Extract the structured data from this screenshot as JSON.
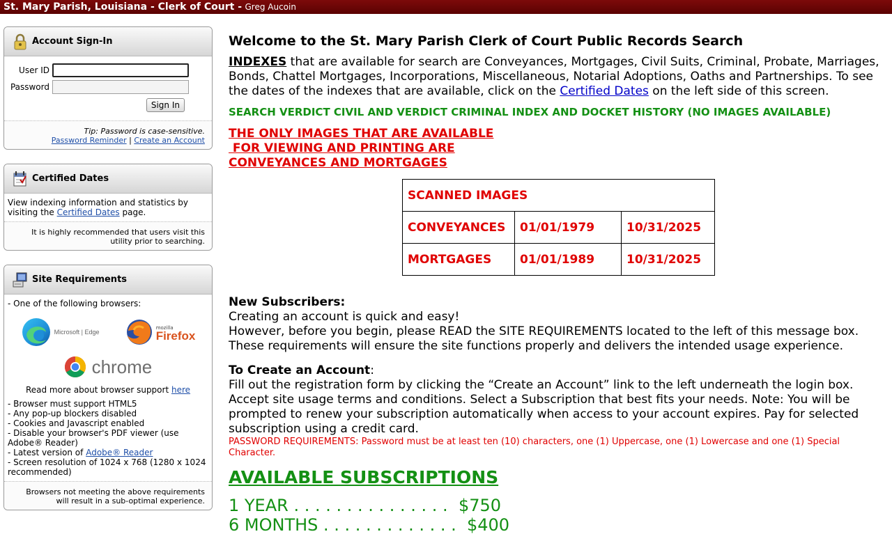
{
  "header": {
    "title": "St. Mary Parish, Louisiana - Clerk of Court -",
    "clerk_name": "Greg Aucoin"
  },
  "sidebar": {
    "signin": {
      "title": "Account Sign-In",
      "user_id_label": "User ID",
      "password_label": "Password",
      "user_id_value": "",
      "password_value": "",
      "signin_button": "Sign In",
      "tip": "Tip: Password is case-sensitive.",
      "password_reminder": "Password Reminder",
      "separator": "|",
      "create_account": "Create an Account"
    },
    "certified": {
      "title": "Certified Dates",
      "text_before": "View indexing information and statistics by visiting the",
      "link": "Certified Dates",
      "text_after": "page.",
      "footer": "It is highly recommended that users visit this utility prior to searching."
    },
    "requirements": {
      "title": "Site Requirements",
      "intro": "- One of the following browsers:",
      "edge_label": "Microsoft | Edge",
      "firefox_small": "mozilla",
      "firefox_label": "Firefox",
      "chrome_label": "chrome",
      "read_more": "Read more about browser support",
      "read_more_link": "here",
      "items": [
        "- Browser must support HTML5",
        "- Any pop-up blockers disabled",
        "- Cookies and Javascript enabled",
        "- Disable your browser's PDF viewer (use Adobe® Reader)"
      ],
      "latest_prefix": "- Latest version of",
      "latest_link": "Adobe® Reader",
      "resolution": "- Screen resolution of 1024 x 768 (1280 x 1024 recommended)",
      "footer": "Browsers not meeting the above requirements will result in a sub-optimal experience."
    }
  },
  "main": {
    "welcome": "Welcome to the St. Mary Parish Clerk of Court Public Records Search",
    "indexes_word": "INDEXES",
    "indexes_text": " that are available for search are Conveyances, Mortgages, Civil Suits, Criminal, Probate, Marriages, Bonds, Chattel Mortgages,  Incorporations, Miscellaneous, Notarial Adoptions, Oaths and Partnerships.  To see the dates of the indexes that are available, click on the ",
    "certified_link": "Certified Dates",
    "indexes_tail": " on the left side of this screen.",
    "green_notice": "SEARCH VERDICT CIVIL AND VERDICT CRIMINAL INDEX AND DOCKET HISTORY (NO IMAGES AVAILABLE)",
    "red_notice": [
      "THE ONLY IMAGES THAT ARE AVAILABLE",
      " FOR VIEWING AND PRINTING ARE",
      "CONVEYANCES AND MORTGAGES"
    ],
    "scan_table": {
      "header": "SCANNED IMAGES",
      "rows": [
        {
          "name": "CONVEYANCES",
          "start": "01/01/1979",
          "end": "10/31/2025"
        },
        {
          "name": "MORTGAGES",
          "start": "01/01/1989",
          "end": "10/31/2025"
        }
      ]
    },
    "new_subs_heading": "New Subscribers:",
    "new_subs_lines": [
      "Creating an account is quick and easy!",
      "However, before you begin, please READ the SITE REQUIREMENTS located to the left of this message box.  These requirements will ensure the site functions properly and delivers the intended usage experience."
    ],
    "create_heading": "To Create an Account",
    "create_colon": ":",
    "create_text": "Fill out the registration form by clicking the “Create an Account” link to the left underneath the login box.  Accept site usage terms and conditions.  Select a Subscription that best fits your needs. Note: You will be prompted to renew your subscription automatically when access to your account expires.  Pay for selected subscription using a credit card.",
    "password_req": "PASSWORD REQUIREMENTS:  Password must be at least ten (10) characters, one (1) Uppercase, one (1)  Lowercase and one (1) Special Character.",
    "avail_heading": "AVAILABLE SUBSCRIPTIONS",
    "subscriptions": [
      "1 YEAR . . . . . . . . . . . . . . .  $750",
      "6 MONTHS . . . . . . . . . . . . .  $400"
    ]
  }
}
